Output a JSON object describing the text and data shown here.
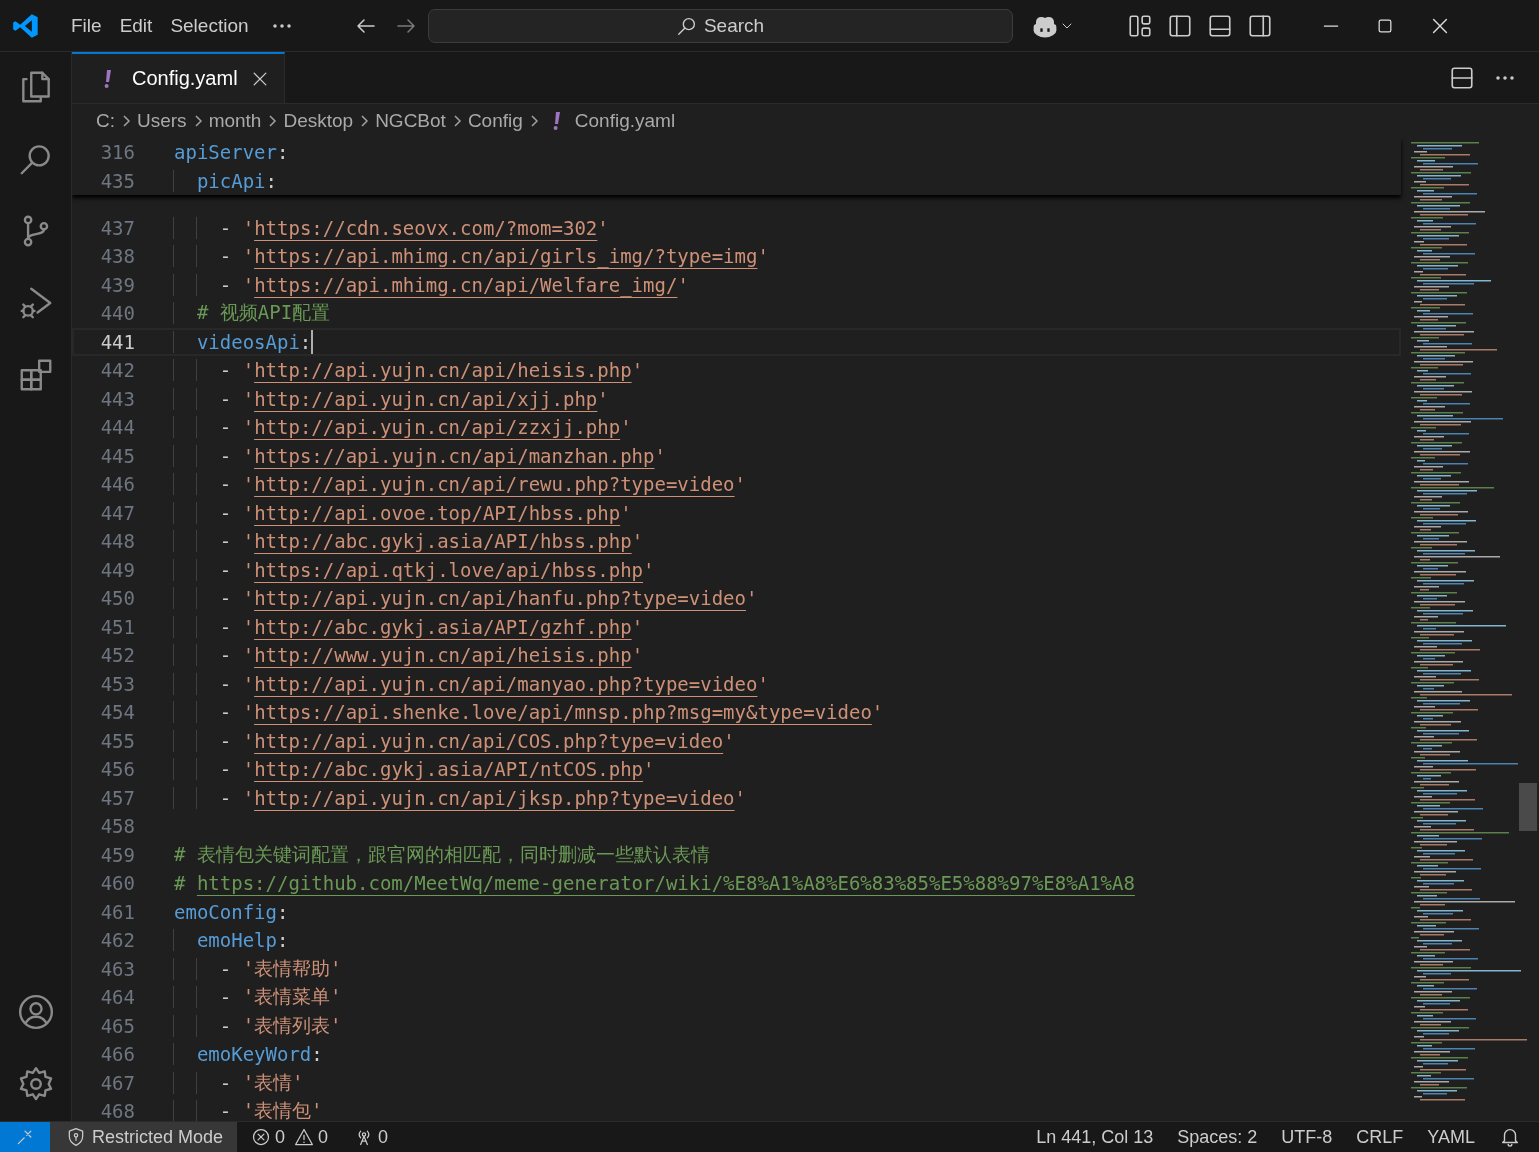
{
  "title_bar": {
    "menu": [
      "File",
      "Edit",
      "Selection"
    ],
    "search_label": "Search"
  },
  "tabs": [
    {
      "label": "Config.yaml",
      "selected": true
    }
  ],
  "breadcrumb": [
    "C:",
    "Users",
    "month",
    "Desktop",
    "NGCBot",
    "Config",
    "Config.yaml"
  ],
  "sticky_lines": [
    {
      "number": "316",
      "tokens": [
        {
          "kind": "key",
          "text": "apiServer"
        },
        {
          "kind": "punct",
          "text": ":"
        }
      ]
    },
    {
      "number": "435",
      "tokens": [
        {
          "kind": "key",
          "text": "  picApi"
        },
        {
          "kind": "punct",
          "text": ":"
        }
      ]
    }
  ],
  "lines": [
    {
      "number": "437",
      "selected": false,
      "tokens": [
        {
          "kind": "punct",
          "text": "    - "
        },
        {
          "kind": "string",
          "text": "'"
        },
        {
          "kind": "url",
          "text": "https://cdn.seovx.com/?mom=302"
        },
        {
          "kind": "string",
          "text": "'"
        }
      ]
    },
    {
      "number": "438",
      "selected": false,
      "tokens": [
        {
          "kind": "punct",
          "text": "    - "
        },
        {
          "kind": "string",
          "text": "'"
        },
        {
          "kind": "url",
          "text": "https://api.mhimg.cn/api/girls_img/?type=img"
        },
        {
          "kind": "string",
          "text": "'"
        }
      ]
    },
    {
      "number": "439",
      "selected": false,
      "tokens": [
        {
          "kind": "punct",
          "text": "    - "
        },
        {
          "kind": "string",
          "text": "'"
        },
        {
          "kind": "url",
          "text": "https://api.mhimg.cn/api/Welfare_img/"
        },
        {
          "kind": "string",
          "text": "'"
        }
      ]
    },
    {
      "number": "440",
      "selected": false,
      "tokens": [
        {
          "kind": "comment",
          "text": "  # 视频API配置"
        }
      ]
    },
    {
      "number": "441",
      "selected": true,
      "tokens": [
        {
          "kind": "key",
          "text": "  videosApi"
        },
        {
          "kind": "punct",
          "text": ":"
        }
      ]
    },
    {
      "number": "442",
      "selected": false,
      "tokens": [
        {
          "kind": "punct",
          "text": "    - "
        },
        {
          "kind": "string",
          "text": "'"
        },
        {
          "kind": "url",
          "text": "http://api.yujn.cn/api/heisis.php"
        },
        {
          "kind": "string",
          "text": "'"
        }
      ]
    },
    {
      "number": "443",
      "selected": false,
      "tokens": [
        {
          "kind": "punct",
          "text": "    - "
        },
        {
          "kind": "string",
          "text": "'"
        },
        {
          "kind": "url",
          "text": "http://api.yujn.cn/api/xjj.php"
        },
        {
          "kind": "string",
          "text": "'"
        }
      ]
    },
    {
      "number": "444",
      "selected": false,
      "tokens": [
        {
          "kind": "punct",
          "text": "    - "
        },
        {
          "kind": "string",
          "text": "'"
        },
        {
          "kind": "url",
          "text": "http://api.yujn.cn/api/zzxjj.php"
        },
        {
          "kind": "string",
          "text": "'"
        }
      ]
    },
    {
      "number": "445",
      "selected": false,
      "tokens": [
        {
          "kind": "punct",
          "text": "    - "
        },
        {
          "kind": "string",
          "text": "'"
        },
        {
          "kind": "url",
          "text": "https://api.yujn.cn/api/manzhan.php"
        },
        {
          "kind": "string",
          "text": "'"
        }
      ]
    },
    {
      "number": "446",
      "selected": false,
      "tokens": [
        {
          "kind": "punct",
          "text": "    - "
        },
        {
          "kind": "string",
          "text": "'"
        },
        {
          "kind": "url",
          "text": "http://api.yujn.cn/api/rewu.php?type=video"
        },
        {
          "kind": "string",
          "text": "'"
        }
      ]
    },
    {
      "number": "447",
      "selected": false,
      "tokens": [
        {
          "kind": "punct",
          "text": "    - "
        },
        {
          "kind": "string",
          "text": "'"
        },
        {
          "kind": "url",
          "text": "http://api.ovoe.top/API/hbss.php"
        },
        {
          "kind": "string",
          "text": "'"
        }
      ]
    },
    {
      "number": "448",
      "selected": false,
      "tokens": [
        {
          "kind": "punct",
          "text": "    - "
        },
        {
          "kind": "string",
          "text": "'"
        },
        {
          "kind": "url",
          "text": "http://abc.gykj.asia/API/hbss.php"
        },
        {
          "kind": "string",
          "text": "'"
        }
      ]
    },
    {
      "number": "449",
      "selected": false,
      "tokens": [
        {
          "kind": "punct",
          "text": "    - "
        },
        {
          "kind": "string",
          "text": "'"
        },
        {
          "kind": "url",
          "text": "https://api.qtkj.love/api/hbss.php"
        },
        {
          "kind": "string",
          "text": "'"
        }
      ]
    },
    {
      "number": "450",
      "selected": false,
      "tokens": [
        {
          "kind": "punct",
          "text": "    - "
        },
        {
          "kind": "string",
          "text": "'"
        },
        {
          "kind": "url",
          "text": "http://api.yujn.cn/api/hanfu.php?type=video"
        },
        {
          "kind": "string",
          "text": "'"
        }
      ]
    },
    {
      "number": "451",
      "selected": false,
      "tokens": [
        {
          "kind": "punct",
          "text": "    - "
        },
        {
          "kind": "string",
          "text": "'"
        },
        {
          "kind": "url",
          "text": "http://abc.gykj.asia/API/gzhf.php"
        },
        {
          "kind": "string",
          "text": "'"
        }
      ]
    },
    {
      "number": "452",
      "selected": false,
      "tokens": [
        {
          "kind": "punct",
          "text": "    - "
        },
        {
          "kind": "string",
          "text": "'"
        },
        {
          "kind": "url",
          "text": "http://www.yujn.cn/api/heisis.php"
        },
        {
          "kind": "string",
          "text": "'"
        }
      ]
    },
    {
      "number": "453",
      "selected": false,
      "tokens": [
        {
          "kind": "punct",
          "text": "    - "
        },
        {
          "kind": "string",
          "text": "'"
        },
        {
          "kind": "url",
          "text": "http://api.yujn.cn/api/manyao.php?type=video"
        },
        {
          "kind": "string",
          "text": "'"
        }
      ]
    },
    {
      "number": "454",
      "selected": false,
      "tokens": [
        {
          "kind": "punct",
          "text": "    - "
        },
        {
          "kind": "string",
          "text": "'"
        },
        {
          "kind": "url",
          "text": "https://api.shenke.love/api/mnsp.php?msg=my&type=video"
        },
        {
          "kind": "string",
          "text": "'"
        }
      ]
    },
    {
      "number": "455",
      "selected": false,
      "tokens": [
        {
          "kind": "punct",
          "text": "    - "
        },
        {
          "kind": "string",
          "text": "'"
        },
        {
          "kind": "url",
          "text": "http://api.yujn.cn/api/COS.php?type=video"
        },
        {
          "kind": "string",
          "text": "'"
        }
      ]
    },
    {
      "number": "456",
      "selected": false,
      "tokens": [
        {
          "kind": "punct",
          "text": "    - "
        },
        {
          "kind": "string",
          "text": "'"
        },
        {
          "kind": "url",
          "text": "http://abc.gykj.asia/API/ntCOS.php"
        },
        {
          "kind": "string",
          "text": "'"
        }
      ]
    },
    {
      "number": "457",
      "selected": false,
      "tokens": [
        {
          "kind": "punct",
          "text": "    - "
        },
        {
          "kind": "string",
          "text": "'"
        },
        {
          "kind": "url",
          "text": "http://api.yujn.cn/api/jksp.php?type=video"
        },
        {
          "kind": "string",
          "text": "'"
        }
      ]
    },
    {
      "number": "458",
      "selected": false
    },
    {
      "number": "459",
      "selected": false,
      "tokens": [
        {
          "kind": "comment",
          "text": "# 表情包关键词配置，跟官网的相匹配，同时删减一些默认表情"
        }
      ]
    },
    {
      "number": "460",
      "selected": false,
      "tokens": [
        {
          "kind": "comment",
          "text": "# "
        },
        {
          "kind": "comment_url",
          "text": "https://github.com/MeetWq/meme-generator/wiki/%E8%A1%A8%E6%83%85%E5%88%97%E8%A1%A8"
        }
      ]
    },
    {
      "number": "461",
      "selected": false,
      "tokens": [
        {
          "kind": "key",
          "text": "emoConfig"
        },
        {
          "kind": "punct",
          "text": ":"
        }
      ]
    },
    {
      "number": "462",
      "selected": false,
      "tokens": [
        {
          "kind": "key",
          "text": "  emoHelp"
        },
        {
          "kind": "punct",
          "text": ":"
        }
      ]
    },
    {
      "number": "463",
      "selected": false,
      "tokens": [
        {
          "kind": "punct",
          "text": "    - "
        },
        {
          "kind": "string",
          "text": "'表情帮助'"
        }
      ]
    },
    {
      "number": "464",
      "selected": false,
      "tokens": [
        {
          "kind": "punct",
          "text": "    - "
        },
        {
          "kind": "string",
          "text": "'表情菜单'"
        }
      ]
    },
    {
      "number": "465",
      "selected": false,
      "tokens": [
        {
          "kind": "punct",
          "text": "    - "
        },
        {
          "kind": "string",
          "text": "'表情列表'"
        }
      ]
    },
    {
      "number": "466",
      "selected": false,
      "tokens": [
        {
          "kind": "key",
          "text": "  emoKeyWord"
        },
        {
          "kind": "punct",
          "text": ":"
        }
      ]
    },
    {
      "number": "467",
      "selected": false,
      "tokens": [
        {
          "kind": "punct",
          "text": "    - "
        },
        {
          "kind": "string",
          "text": "'表情'"
        }
      ]
    },
    {
      "number": "468",
      "selected": false,
      "tokens": [
        {
          "kind": "punct",
          "text": "    - "
        },
        {
          "kind": "string",
          "text": "'表情包'"
        }
      ]
    }
  ],
  "status_bar": {
    "restricted_mode": "Restricted Mode",
    "errors": "0",
    "warnings": "0",
    "ports": "0",
    "position": "Ln 441, Col 13",
    "indentation": "Spaces: 2",
    "encoding": "UTF-8",
    "line_ending": "CRLF",
    "language": "YAML"
  }
}
